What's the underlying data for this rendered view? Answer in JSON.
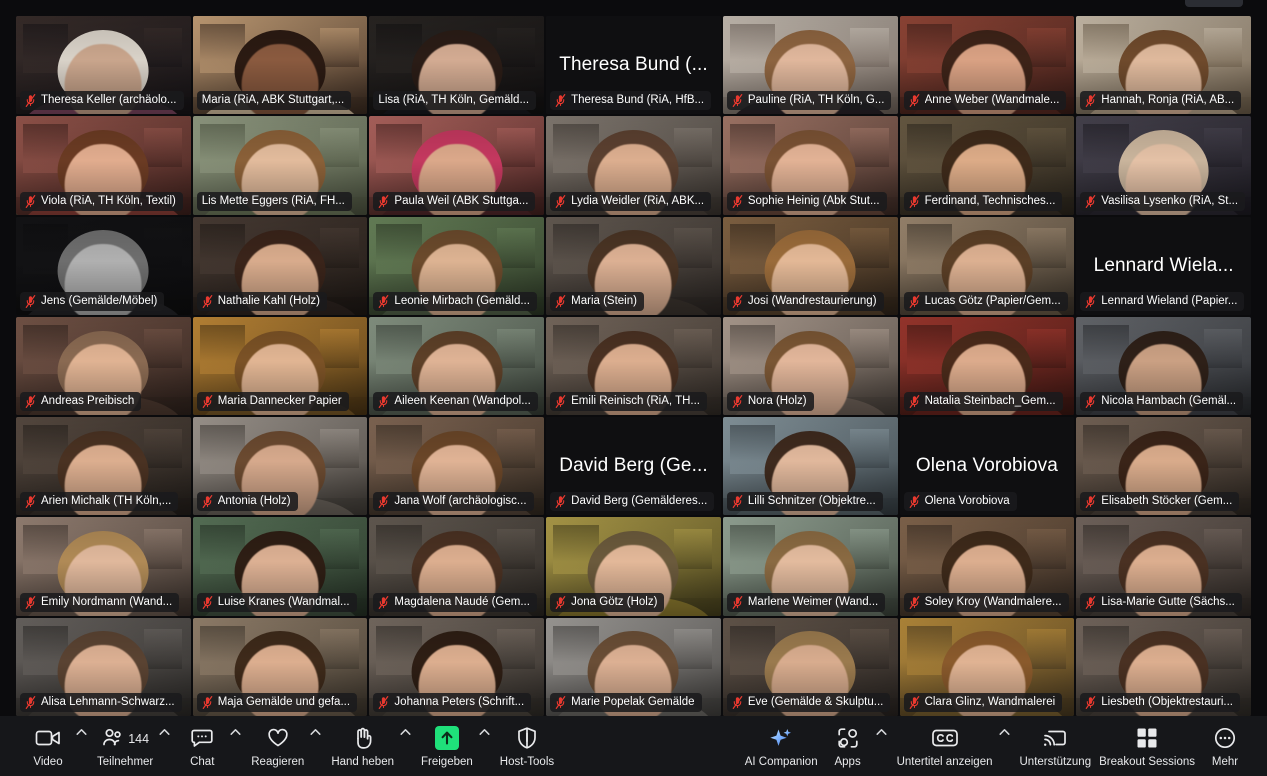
{
  "meeting": {
    "layout": "gallery",
    "columns": 7,
    "rows": 7,
    "active_speaker_index": 7,
    "active_border_color": "#2ecc71",
    "background": "#0b0b0d"
  },
  "participants": [
    {
      "name": "Theresa Keller (archäolo...",
      "muted": true,
      "video": true,
      "bigname": null,
      "bg1": "#3b2f2c",
      "bg2": "#171417",
      "skin": "#c9a58c",
      "hair": "#d9d2c8",
      "shirt": "#7d4660"
    },
    {
      "name": "Maria (RiA, ABK Stuttgart,...",
      "muted": false,
      "video": true,
      "bigname": null,
      "bg1": "#cfa87e",
      "bg2": "#3a2a20",
      "skin": "#8a5a3f",
      "hair": "#2b1a12",
      "shirt": "#d8c2a2"
    },
    {
      "name": "Lisa (RiA, TH Köln, Gemäld...",
      "muted": false,
      "video": true,
      "bigname": null,
      "bg1": "#2b2724",
      "bg2": "#121011",
      "skin": "#d3ab92",
      "hair": "#2a1c16",
      "shirt": "#1a1a1f"
    },
    {
      "name": "Theresa Bund (RiA, HfB...",
      "muted": true,
      "video": false,
      "bigname": "Theresa Bund (...",
      "bg1": "#0f0f11",
      "bg2": "#0f0f11",
      "skin": "#0f0f11",
      "hair": "#0f0f11",
      "shirt": "#0f0f11"
    },
    {
      "name": "Pauline (RiA, TH Köln, G...",
      "muted": true,
      "video": true,
      "bigname": null,
      "bg1": "#cfc6bb",
      "bg2": "#6e625a",
      "skin": "#e0b79c",
      "hair": "#8d6440",
      "shirt": "#2a2228"
    },
    {
      "name": "Anne Weber (Wandmale...",
      "muted": true,
      "video": true,
      "bigname": null,
      "bg1": "#9a4a3a",
      "bg2": "#3a1d18",
      "skin": "#d9a183",
      "hair": "#3d2318",
      "shirt": "#5a2a22"
    },
    {
      "name": "Hannah, Ronja (RiA, AB...",
      "muted": true,
      "video": true,
      "bigname": null,
      "bg1": "#d3c6b3",
      "bg2": "#6b5c49",
      "skin": "#dfb99c",
      "hair": "#6f4a2c",
      "shirt": "#bda98e"
    },
    {
      "name": "Viola (RiA, TH Köln, Textil)",
      "muted": true,
      "video": true,
      "bigname": null,
      "bg1": "#9d5a50",
      "bg2": "#3c201c",
      "skin": "#e1ac8e",
      "hair": "#6b3b23",
      "shirt": "#8f4038"
    },
    {
      "name": "Lis Mette Eggers (RiA, FH...",
      "muted": false,
      "video": true,
      "bigname": null,
      "bg1": "#9aa48a",
      "bg2": "#4c5340",
      "skin": "#e2bb9c",
      "hair": "#8a6038",
      "shirt": "#6e7a5c"
    },
    {
      "name": "Paula Weil (ABK Stuttga...",
      "muted": true,
      "video": true,
      "bigname": null,
      "bg1": "#b96a64",
      "bg2": "#43211f",
      "skin": "#dba88a",
      "hair": "#c4385f",
      "shirt": "#53282b"
    },
    {
      "name": "Lydia Weidler (RiA, ABK...",
      "muted": true,
      "video": true,
      "bigname": null,
      "bg1": "#8b8279",
      "bg2": "#3a342f",
      "skin": "#dcae8f",
      "hair": "#5b4030",
      "shirt": "#4b423b"
    },
    {
      "name": "Sophie Heinig (Abk Stut...",
      "muted": true,
      "video": true,
      "bigname": null,
      "bg1": "#ad7f6f",
      "bg2": "#3d2a24",
      "skin": "#e2b295",
      "hair": "#7a5234",
      "shirt": "#6b4a3c"
    },
    {
      "name": "Ferdinand, Technisches...",
      "muted": true,
      "video": true,
      "bigname": null,
      "bg1": "#6f6048",
      "bg2": "#2b251c",
      "skin": "#dcab87",
      "hair": "#3e2a1a",
      "shirt": "#3a3128"
    },
    {
      "name": "Vasilisa Lysenko (RiA, St...",
      "muted": true,
      "video": true,
      "bigname": null,
      "bg1": "#4b4753",
      "bg2": "#1d1b22",
      "skin": "#e4c1a6",
      "hair": "#c9b49c",
      "shirt": "#2c2933"
    },
    {
      "name": "Jens (Gemälde/Möbel)",
      "muted": true,
      "video": true,
      "bigname": null,
      "bg1": "#141416",
      "bg2": "#0d0d0f",
      "skin": "#b0b0b0",
      "hair": "#6e6e6e",
      "shirt": "#242428"
    },
    {
      "name": "Nathalie Kahl (Holz)",
      "muted": true,
      "video": true,
      "bigname": null,
      "bg1": "#4e4038",
      "bg2": "#1e1814",
      "skin": "#d8ab8c",
      "hair": "#3a241a",
      "shirt": "#2e2420"
    },
    {
      "name": "Leonie Mirbach (Gemäld...",
      "muted": true,
      "video": true,
      "bigname": null,
      "bg1": "#6e8a5f",
      "bg2": "#2b3624",
      "skin": "#ddb392",
      "hair": "#6b4a2c",
      "shirt": "#53634a"
    },
    {
      "name": "Maria (Stein)",
      "muted": true,
      "video": true,
      "bigname": null,
      "bg1": "#6b6158",
      "bg2": "#2a2522",
      "skin": "#dcb093",
      "hair": "#4a3424",
      "shirt": "#3b342e"
    },
    {
      "name": "Josi (Wandrestaurierung)",
      "muted": true,
      "video": true,
      "bigname": null,
      "bg1": "#8b6a48",
      "bg2": "#31251a",
      "skin": "#e3b896",
      "hair": "#9a6b3a",
      "shirt": "#5a452e"
    },
    {
      "name": "Lucas Götz (Papier/Gem...",
      "muted": true,
      "video": true,
      "bigname": null,
      "bg1": "#a58f76",
      "bg2": "#3a3228",
      "skin": "#dcb091",
      "hair": "#5b3f26",
      "shirt": "#6a5b47"
    },
    {
      "name": "Lennard Wieland (Papier...",
      "muted": true,
      "video": false,
      "bigname": "Lennard Wiela...",
      "bg1": "#0f0f11",
      "bg2": "#0f0f11",
      "skin": "#0f0f11",
      "hair": "#0f0f11",
      "shirt": "#0f0f11"
    },
    {
      "name": "Andreas Preibisch",
      "muted": true,
      "video": true,
      "bigname": null,
      "bg1": "#7c5a4c",
      "bg2": "#2e211c",
      "skin": "#e0b393",
      "hair": "#8a6a52",
      "shirt": "#4e3a30"
    },
    {
      "name": "Maria Dannecker Papier",
      "muted": true,
      "video": true,
      "bigname": null,
      "bg1": "#c98f3a",
      "bg2": "#4a3414",
      "skin": "#e1b593",
      "hair": "#7b5226",
      "shirt": "#7a5a28"
    },
    {
      "name": "Aileen Keenan (Wandpol...",
      "muted": true,
      "video": true,
      "bigname": null,
      "bg1": "#8f9e8c",
      "bg2": "#363d35",
      "skin": "#dfb395",
      "hair": "#5d4028",
      "shirt": "#5b6659"
    },
    {
      "name": "Emili Reinisch (RiA, TH...",
      "muted": true,
      "video": true,
      "bigname": null,
      "bg1": "#7f7064",
      "bg2": "#302a25",
      "skin": "#dcae8f",
      "hair": "#4a3122",
      "shirt": "#4a413a"
    },
    {
      "name": "Nora (Holz)",
      "muted": true,
      "video": true,
      "bigname": null,
      "bg1": "#b8a79a",
      "bg2": "#463e38",
      "skin": "#e2b69a",
      "hair": "#7a5634",
      "shirt": "#6e6158"
    },
    {
      "name": "Natalia Steinbach_Gem...",
      "muted": true,
      "video": true,
      "bigname": null,
      "bg1": "#a63a30",
      "bg2": "#3a1612",
      "skin": "#dcab8c",
      "hair": "#4a2a1a",
      "shirt": "#6c241e"
    },
    {
      "name": "Nicola Hambach (Gemäl...",
      "muted": true,
      "video": true,
      "bigname": null,
      "bg1": "#6c6f74",
      "bg2": "#282a2e",
      "skin": "#caa083",
      "hair": "#2e2018",
      "shirt": "#40434a"
    },
    {
      "name": "Arien Michalk (TH Köln,...",
      "muted": true,
      "video": true,
      "bigname": null,
      "bg1": "#5d4f45",
      "bg2": "#231e1a",
      "skin": "#dcae8f",
      "hair": "#4a3222",
      "shirt": "#3a322c"
    },
    {
      "name": "Antonia (Holz)",
      "muted": true,
      "video": true,
      "bigname": null,
      "bg1": "#a9a199",
      "bg2": "#403b36",
      "skin": "#d6a98c",
      "hair": "#6b4a30",
      "shirt": "#6b645c"
    },
    {
      "name": "Jana Wolf (archäologisc...",
      "muted": true,
      "video": true,
      "bigname": null,
      "bg1": "#8a6e5a",
      "bg2": "#322920",
      "skin": "#e0b395",
      "hair": "#6a4628",
      "shirt": "#56463a"
    },
    {
      "name": "David Berg (Gemälderes...",
      "muted": true,
      "video": false,
      "bigname": "David Berg (Ge...",
      "bg1": "#0f0f11",
      "bg2": "#0f0f11",
      "skin": "#0f0f11",
      "hair": "#0f0f11",
      "shirt": "#0f0f11"
    },
    {
      "name": "Lilli Schnitzer (Objektre...",
      "muted": true,
      "video": true,
      "bigname": null,
      "bg1": "#8fa0a8",
      "bg2": "#343c41",
      "skin": "#e1b89c",
      "hair": "#3e2a1e",
      "shirt": "#5b686e"
    },
    {
      "name": "Olena Vorobiova",
      "muted": true,
      "video": false,
      "bigname": "Olena Vorobiova",
      "bg1": "#0f0f11",
      "bg2": "#0f0f11",
      "skin": "#0f0f11",
      "hair": "#0f0f11",
      "shirt": "#0f0f11"
    },
    {
      "name": "Elisabeth Stöcker (Gem...",
      "muted": true,
      "video": true,
      "bigname": null,
      "bg1": "#7c6a5c",
      "bg2": "#2e2721",
      "skin": "#d9ab8b",
      "hair": "#3a2418",
      "shirt": "#4e443c"
    },
    {
      "name": "Emily Nordmann (Wand...",
      "muted": true,
      "video": true,
      "bigname": null,
      "bg1": "#a08a7c",
      "bg2": "#3c322c",
      "skin": "#e0b89c",
      "hair": "#b08a56",
      "shirt": "#6a5a50"
    },
    {
      "name": "Luise Kranes (Wandmal...",
      "muted": true,
      "video": true,
      "bigname": null,
      "bg1": "#5e7a5e",
      "bg2": "#243024",
      "skin": "#dcb093",
      "hair": "#2e1e14",
      "shirt": "#415241"
    },
    {
      "name": "Magdalena Naudé (Gem...",
      "muted": true,
      "video": true,
      "bigname": null,
      "bg1": "#6a6158",
      "bg2": "#282420",
      "skin": "#dcae8f",
      "hair": "#4a3122",
      "shirt": "#3e3832"
    },
    {
      "name": "Jona Götz (Holz)",
      "muted": true,
      "video": true,
      "bigname": null,
      "bg1": "#b9a64e",
      "bg2": "#443e1c",
      "skin": "#e3b899",
      "hair": "#6b5a3c",
      "shirt": "#8c7a2e"
    },
    {
      "name": "Marlene Weimer (Wand...",
      "muted": true,
      "video": true,
      "bigname": null,
      "bg1": "#9fb0a0",
      "bg2": "#3a4239",
      "skin": "#e3bb9e",
      "hair": "#8a6a42",
      "shirt": "#6a786a"
    },
    {
      "name": "Soley Kroy (Wandmalere...",
      "muted": true,
      "video": true,
      "bigname": null,
      "bg1": "#8a6c52",
      "bg2": "#332820",
      "skin": "#dcae8f",
      "hair": "#3e2a1a",
      "shirt": "#5a4634"
    },
    {
      "name": "Lisa-Marie Gutte (Sächs...",
      "muted": true,
      "video": true,
      "bigname": null,
      "bg1": "#7a6c64",
      "bg2": "#2e2824",
      "skin": "#dcae8f",
      "hair": "#4a3122",
      "shirt": "#4a423c"
    },
    {
      "name": "Alisa Lehmann-Schwarz...",
      "muted": true,
      "video": true,
      "bigname": null,
      "bg1": "#6f6a66",
      "bg2": "#2a2826",
      "skin": "#dcb093",
      "hair": "#5a4332",
      "shirt": "#46423e"
    },
    {
      "name": "Maja Gemälde und gefa...",
      "muted": true,
      "video": true,
      "bigname": null,
      "bg1": "#9e8a74",
      "bg2": "#3a332a",
      "skin": "#dcae8f",
      "hair": "#3e2a1a",
      "shirt": "#6a5c4c"
    },
    {
      "name": "Johanna Peters (Schrift...",
      "muted": true,
      "video": true,
      "bigname": null,
      "bg1": "#7e7268",
      "bg2": "#2e2a26",
      "skin": "#dcae8f",
      "hair": "#2e1e14",
      "shirt": "#4c463e"
    },
    {
      "name": "Marie Popelak Gemälde",
      "muted": true,
      "video": true,
      "bigname": null,
      "bg1": "#a9a6a2",
      "bg2": "#403e3c",
      "skin": "#dcb093",
      "hair": "#6a4e36",
      "shirt": "#6c6a66"
    },
    {
      "name": "Eve (Gemälde & Skulptu...",
      "muted": true,
      "video": true,
      "bigname": null,
      "bg1": "#6a5c50",
      "bg2": "#282320",
      "skin": "#d8ac8e",
      "hair": "#9a7a4e",
      "shirt": "#403830"
    },
    {
      "name": "Clara Glinz, Wandmalerei",
      "muted": true,
      "video": true,
      "bigname": null,
      "bg1": "#c0923e",
      "bg2": "#473820",
      "skin": "#e0b393",
      "hair": "#8a5a2c",
      "shirt": "#7c6230"
    },
    {
      "name": "Liesbeth (Objektrestauri...",
      "muted": true,
      "video": true,
      "bigname": null,
      "bg1": "#7c6e64",
      "bg2": "#2e2a26",
      "skin": "#dcae8f",
      "hair": "#4a3122",
      "shirt": "#4a423c"
    }
  ],
  "toolbar": {
    "left_items": [
      {
        "label": "Video",
        "icon": "camera-icon",
        "caret": true,
        "badge": null
      },
      {
        "label": "Teilnehmer",
        "icon": "participants-icon",
        "caret": true,
        "badge": "144"
      },
      {
        "label": "Chat",
        "icon": "chat-icon",
        "caret": true,
        "badge": null
      },
      {
        "label": "Reagieren",
        "icon": "heart-icon",
        "caret": true,
        "badge": null
      },
      {
        "label": "Hand heben",
        "icon": "raise-hand-icon",
        "caret": true,
        "badge": null
      },
      {
        "label": "Freigeben",
        "icon": "share-screen-icon",
        "caret": true,
        "badge": null
      },
      {
        "label": "Host-Tools",
        "icon": "shield-icon",
        "caret": false,
        "badge": null
      }
    ],
    "right_items": [
      {
        "label": "AI Companion",
        "icon": "ai-sparkle-icon",
        "caret": false,
        "badge": null
      },
      {
        "label": "Apps",
        "icon": "apps-icon",
        "caret": true,
        "badge": null
      },
      {
        "label": "Untertitel anzeigen",
        "icon": "closed-captions-icon",
        "caret": true,
        "badge": null
      },
      {
        "label": "Unterstützung",
        "icon": "cast-support-icon",
        "caret": false,
        "badge": null
      },
      {
        "label": "Breakout Sessions",
        "icon": "breakout-grid-icon",
        "caret": false,
        "badge": null
      },
      {
        "label": "Mehr",
        "icon": "more-ellipsis-icon",
        "caret": false,
        "badge": null
      }
    ],
    "share_accent": "#1fe07a",
    "background": "#16171a"
  }
}
